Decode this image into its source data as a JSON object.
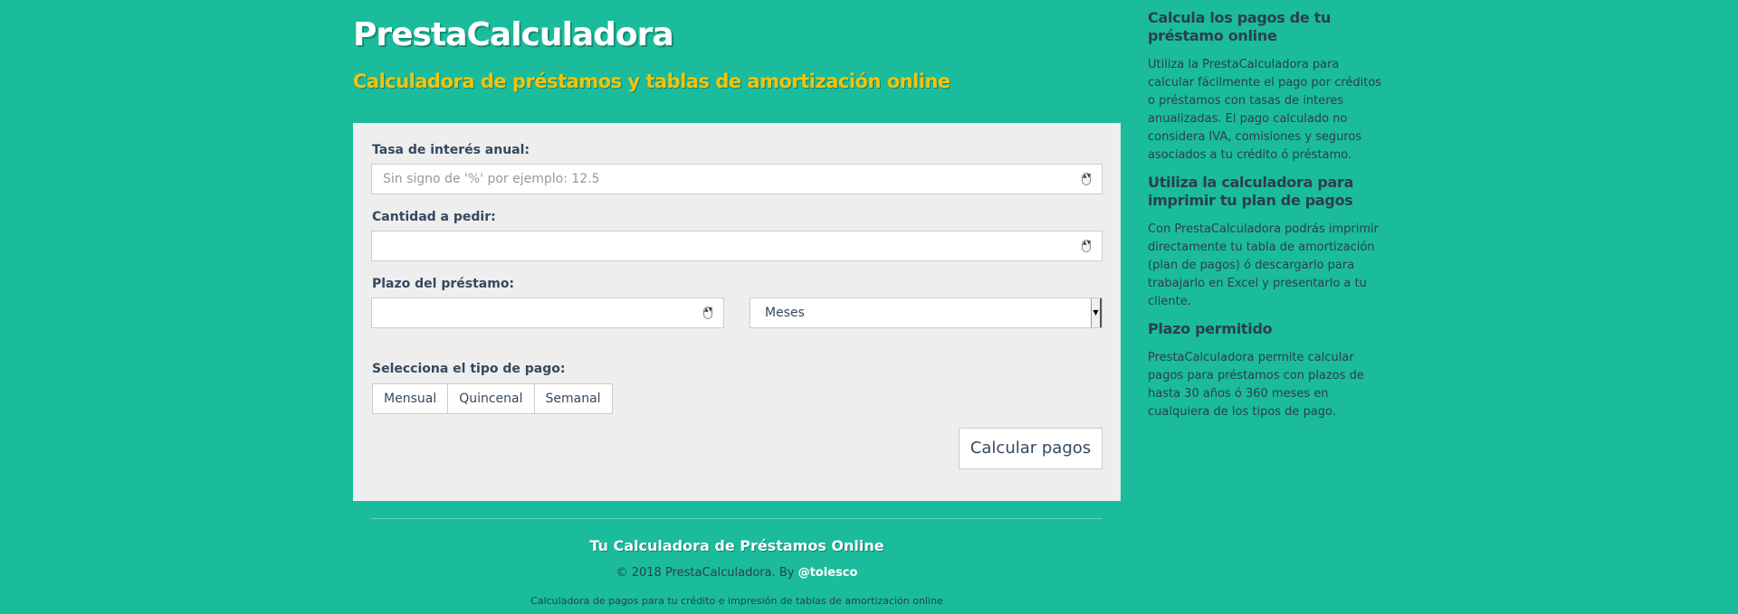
{
  "header": {
    "title": "PrestaCalculadora",
    "subtitle": "Calculadora de préstamos y tablas de amortización online"
  },
  "form": {
    "rate_label": "Tasa de interés anual:",
    "rate_placeholder": "Sin signo de '%' por ejemplo: 12.5",
    "amount_label": "Cantidad a pedir:",
    "amount_value": "",
    "term_label": "Plazo del préstamo:",
    "term_value": "",
    "term_unit": "Meses",
    "payment_type_label": "Selecciona el tipo de pago:",
    "payment_options": [
      "Mensual",
      "Quincenal",
      "Semanal"
    ],
    "calculate_button": "Calcular pagos"
  },
  "footer": {
    "title": "Tu Calculadora de Préstamos Online",
    "copyright": "© 2018 PrestaCalculadora. By ",
    "author": "@tolesco",
    "description": "Calculadora de pagos para tu crédito e impresión de tablas de amortización online"
  },
  "sidebar": {
    "sections": [
      {
        "title": "Calcula los pagos de tu préstamo online",
        "text": "Utiliza la PrestaCalculadora para calcular fácilmente el pago por créditos o préstamos con tasas de interes anualizadas. El pago calculado no considera IVA, comisiones y seguros asociados a tu crédito ó préstamo."
      },
      {
        "title": "Utiliza la calculadora para imprimir tu plan de pagos",
        "text": "Con PrestaCalculadora podrás imprimir directamente tu tabla de amortización (plan de pagos) ó descargarlo para trabajarlo en Excel y presentarlo a tu cliente."
      },
      {
        "title": "Plazo permitido",
        "text": "PrestaCalculadora permite calcular pagos para préstamos con plazos de hasta 30 años ó 360 meses en cualquiera de los tipos de pago."
      }
    ]
  },
  "colors": {
    "background": "#1abc9c",
    "accent": "#f1c40f",
    "text": "#2c3e50",
    "panel": "#eeeeee"
  }
}
